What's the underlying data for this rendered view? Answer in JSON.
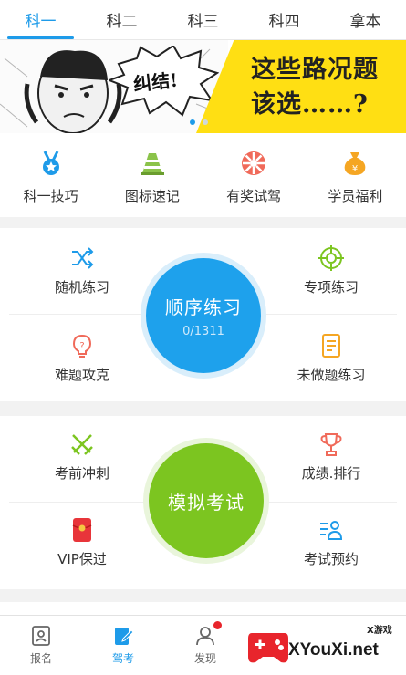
{
  "tabs": [
    "科一",
    "科二",
    "科三",
    "科四",
    "拿本"
  ],
  "banner": {
    "headline_line1": "这些路况题",
    "headline_line2": "该选……?",
    "burst_text": "纠结!"
  },
  "quick_items": [
    {
      "label": "科一技巧",
      "icon": "medal-icon"
    },
    {
      "label": "图标速记",
      "icon": "traffic-cone-icon"
    },
    {
      "label": "有奖试驾",
      "icon": "wheel-icon"
    },
    {
      "label": "学员福利",
      "icon": "money-bag-icon"
    }
  ],
  "practice": {
    "random": "随机练习",
    "special": "专项练习",
    "hard": "难题攻克",
    "undone": "未做题练习",
    "center_title": "顺序练习",
    "center_progress": "0/1311"
  },
  "exam": {
    "sprint": "考前冲刺",
    "ranking": "成绩.排行",
    "vip": "VIP保过",
    "booking": "考试预约",
    "center_title": "模拟考试"
  },
  "nav": [
    {
      "label": "报名",
      "icon": "id-card-icon"
    },
    {
      "label": "驾考",
      "icon": "edit-doc-icon"
    },
    {
      "label": "发现",
      "icon": "person-icon"
    }
  ],
  "watermark": {
    "text": "XYouXi.net",
    "small": "X游戏"
  },
  "colors": {
    "accent": "#1e9be9",
    "green": "#7cc520",
    "yellow": "#ffdf13",
    "badge": "#e8252c"
  }
}
